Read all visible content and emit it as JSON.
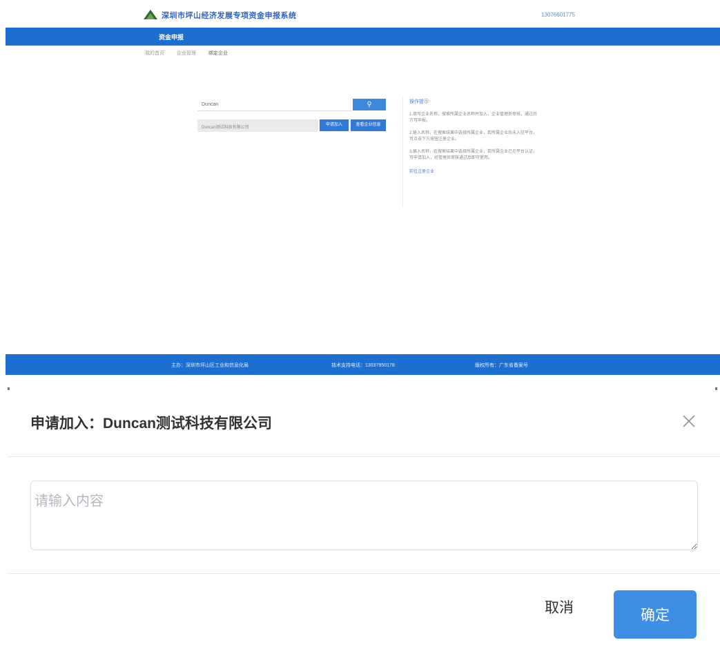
{
  "colors": {
    "nav_blue": "#1c6fd1",
    "primary_button": "#3d8ee4",
    "title_blue": "#2a62c9"
  },
  "background_page": {
    "site_title": "深圳市坪山经济发展专项资金申报系统",
    "phone": "13076601775",
    "nav_item": "资金申报",
    "breadcrumbs": [
      "我的首页",
      "企业管理",
      "绑定企业"
    ],
    "search_value": "Duncan",
    "search_icon": "search-icon",
    "result_company": "Duncan测试科技有限公司",
    "result_button_1": "申请加入",
    "result_button_2": "查看企业信息",
    "tips": {
      "title": "操作提示",
      "lines": [
        "1.填写企业名称，搜索所属企业名称并加入，企业管理员审核，通过后方可申报。",
        "2.输入名称，在搜索结果中选择所属企业，若所属企业尚未入驻平台，可点击下方按钮注册企业。",
        "3.输入名称，在搜索结果中选择所属企业，若所属企业已在平台认证，可申请加入，经管理员审核通过后即可使用。"
      ],
      "link": "前往注册企业"
    },
    "footer": {
      "host": "主办：深圳市坪山区工业和信息化局",
      "support": "技术支持电话：13037950178",
      "record": "版权所有：广东省备案号"
    }
  },
  "dialog": {
    "title": "申请加入：Duncan测试科技有限公司",
    "close_icon": "close-icon",
    "textarea_placeholder": "请输入内容",
    "textarea_value": "",
    "cancel_label": "取消",
    "confirm_label": "确定"
  }
}
